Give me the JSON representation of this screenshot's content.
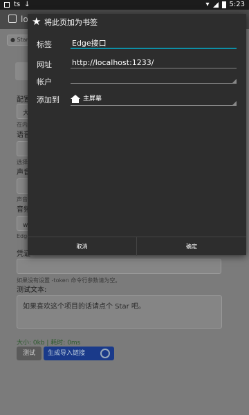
{
  "statusbar": {
    "left_text": "ts",
    "time": "5:23"
  },
  "background": {
    "tab_title": "lo",
    "star_button": "Star",
    "labels": [
      "配置",
      "语音",
      "声音",
      "音频",
      "凭证"
    ],
    "hints": [
      "在内",
      "选择",
      "声音",
      "Edge",
      "如果没有设置 -token 命令行参数请为空。"
    ],
    "select_values": [
      "大",
      "",
      "",
      "w"
    ],
    "test_text_label": "测试文本:",
    "test_text_value": "如果喜欢这个项目的话请点个 Star 吧。",
    "size_time": "大小: 0kb | 耗时: 0ms",
    "test_button": "测试",
    "generate_button": "生成导入链接"
  },
  "dialog": {
    "title": "将此页加为书签",
    "label_label": "标签",
    "label_value": "Edge接口",
    "url_label": "网址",
    "url_value": "http://localhost:1233/",
    "account_label": "帐户",
    "account_value": "",
    "add_to_label": "添加到",
    "add_to_value": "主屏幕",
    "cancel_label": "取消",
    "ok_label": "确定"
  },
  "colors": {
    "accent": "#0d8fa6",
    "dialog_bg": "#2d2d2d"
  }
}
